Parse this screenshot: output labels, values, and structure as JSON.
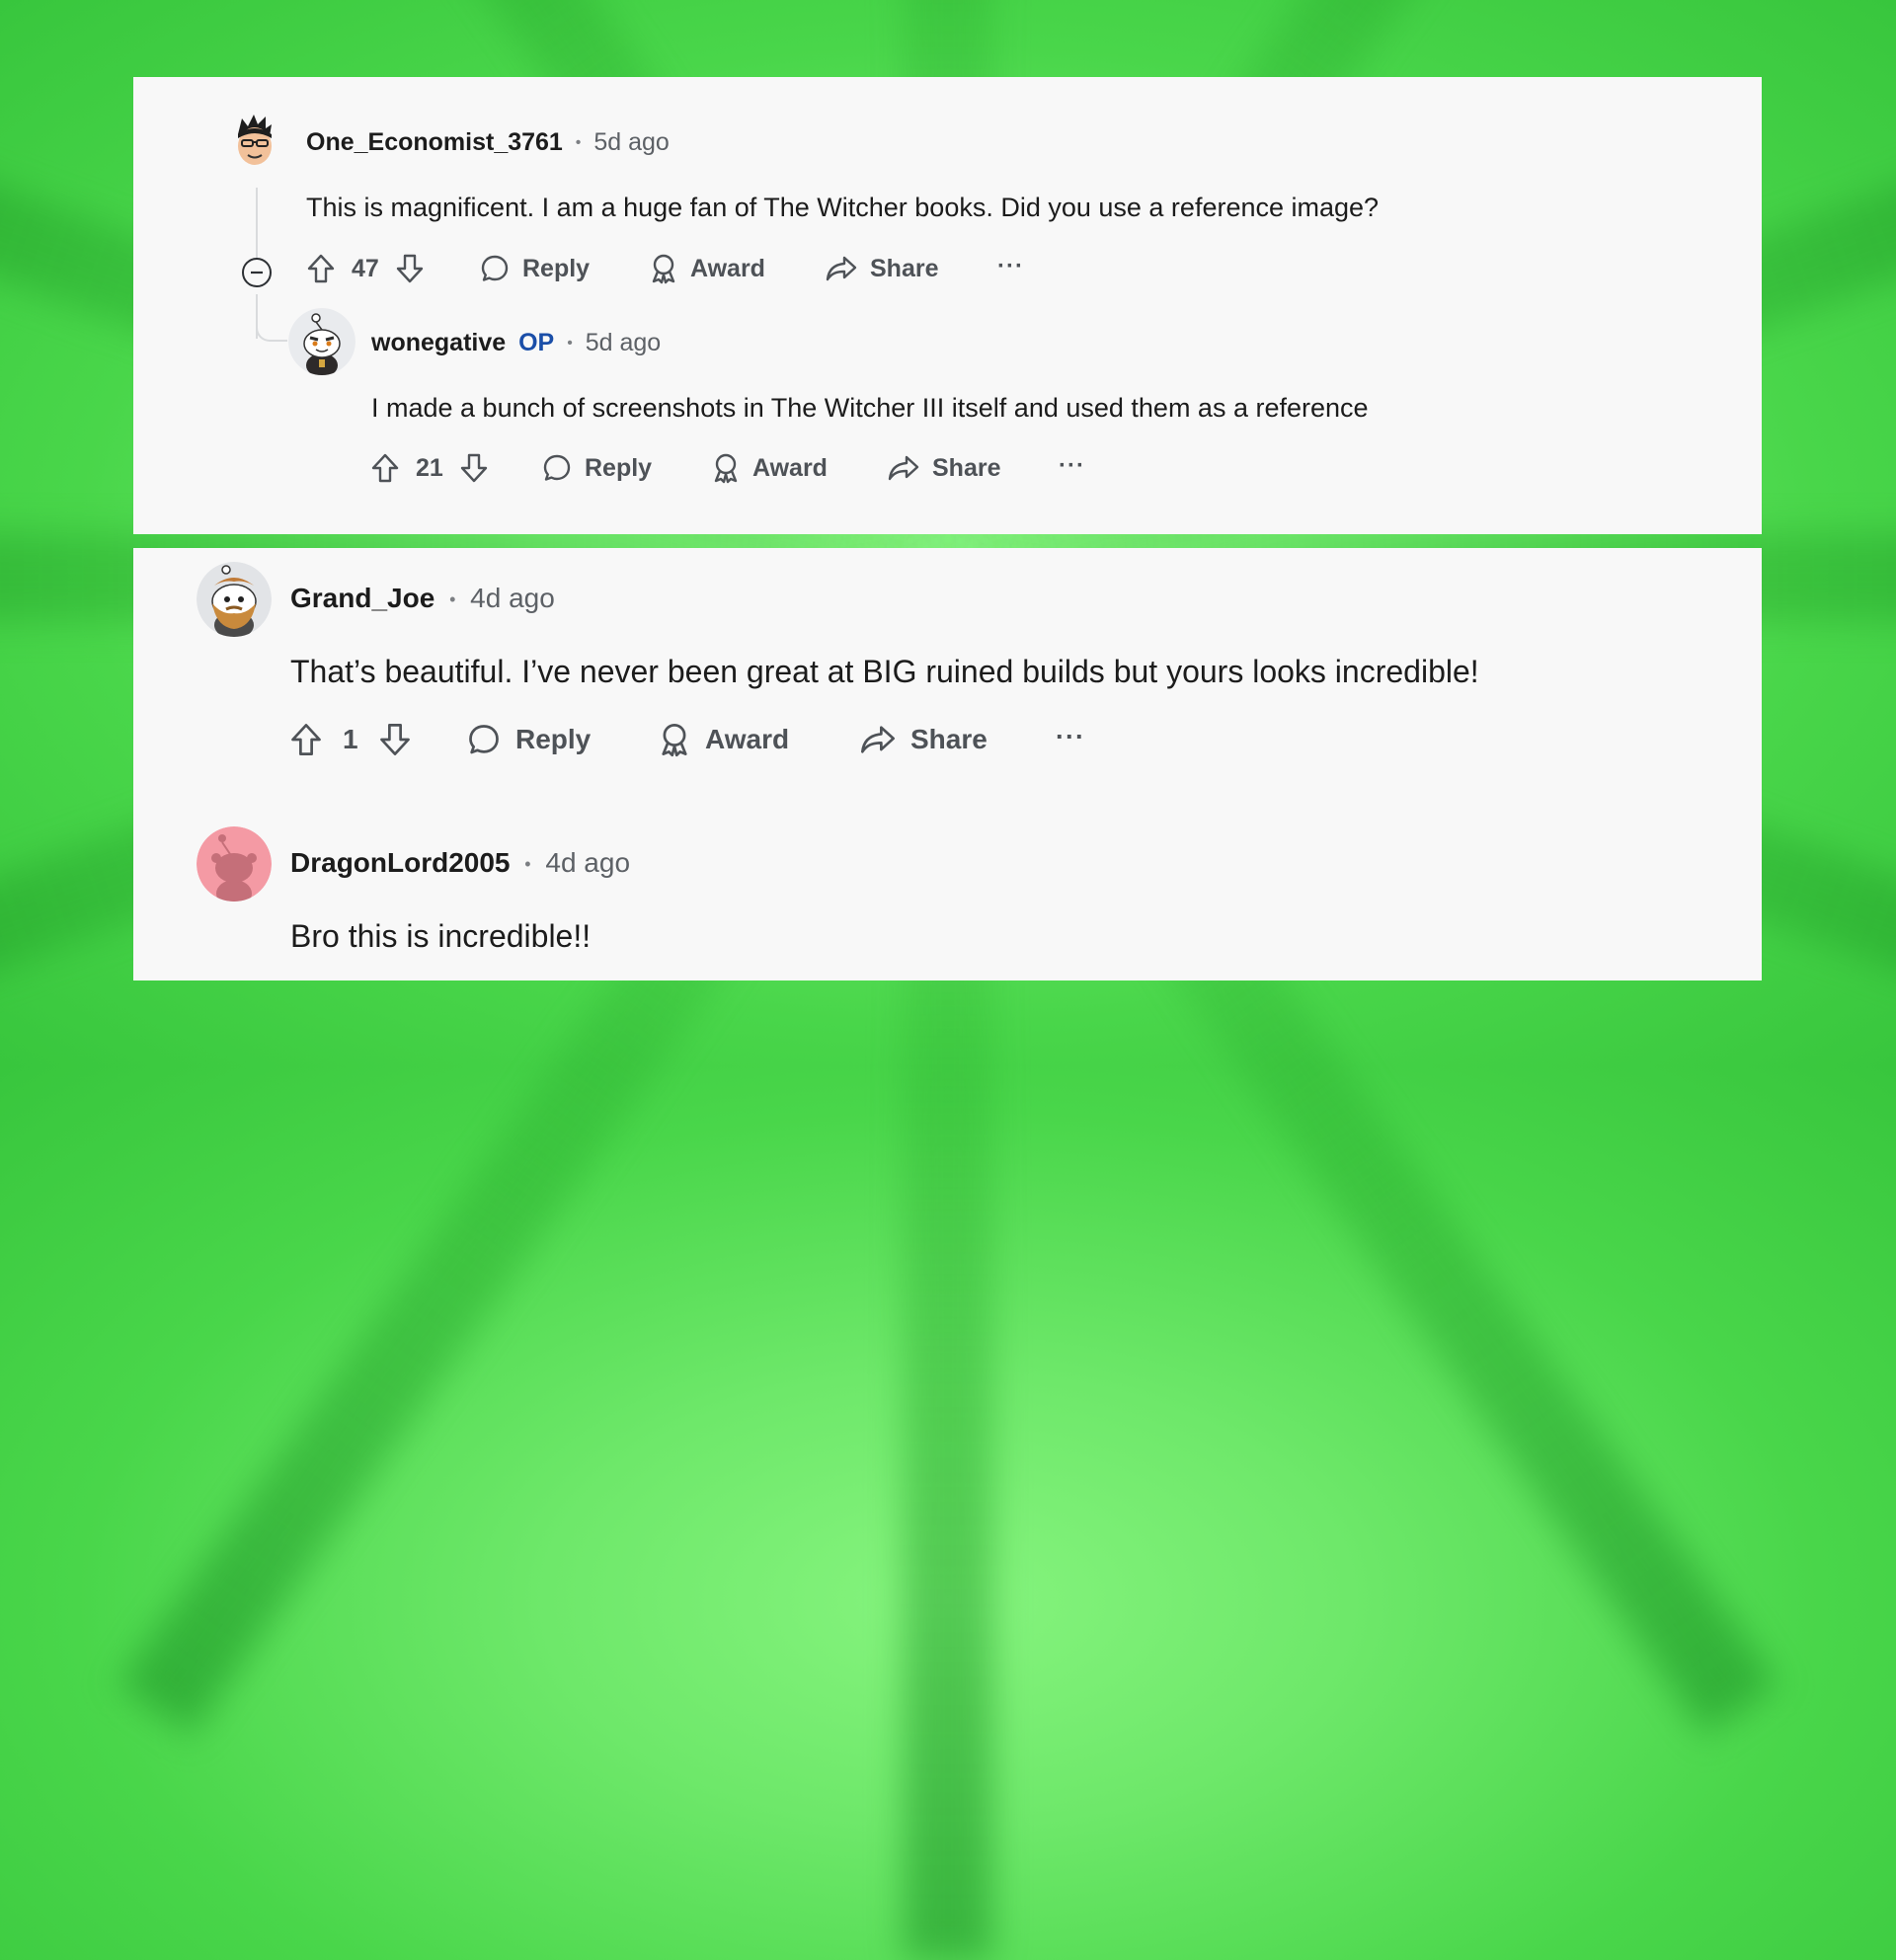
{
  "comments": [
    {
      "username": "One_Economist_3761",
      "separator": "•",
      "time": "5d ago",
      "body": "This is magnificent. I am a huge fan of The Witcher books. Did you use a reference image?",
      "score": "47",
      "actions": {
        "reply": "Reply",
        "award": "Award",
        "share": "Share",
        "more": "···"
      },
      "avatar_icon": "cartoon-man-avatar"
    },
    {
      "username": "wonegative",
      "op_tag": "OP",
      "separator": "•",
      "time": "5d ago",
      "body": "I made a bunch of screenshots in The Witcher III itself and used them as a reference",
      "score": "21",
      "actions": {
        "reply": "Reply",
        "award": "Award",
        "share": "Share",
        "more": "···"
      },
      "avatar_icon": "snoo-witcher-avatar"
    },
    {
      "username": "Grand_Joe",
      "separator": "•",
      "time": "4d ago",
      "body": "That’s beautiful. I’ve never been great at BIG ruined builds but yours looks incredible!",
      "score": "1",
      "actions": {
        "reply": "Reply",
        "award": "Award",
        "share": "Share",
        "more": "···"
      },
      "avatar_icon": "snoo-bearded-avatar"
    },
    {
      "username": "DragonLord2005",
      "separator": "•",
      "time": "4d ago",
      "body": "Bro this is incredible!!",
      "avatar_icon": "default-snoo-avatar"
    }
  ],
  "colors": {
    "background": "#6ee86a",
    "card": "#f8f8f8",
    "op": "#1a4ea8",
    "text": "#1c1c1c",
    "muted": "#5d6166",
    "default_avatar": "#f49aa4"
  }
}
